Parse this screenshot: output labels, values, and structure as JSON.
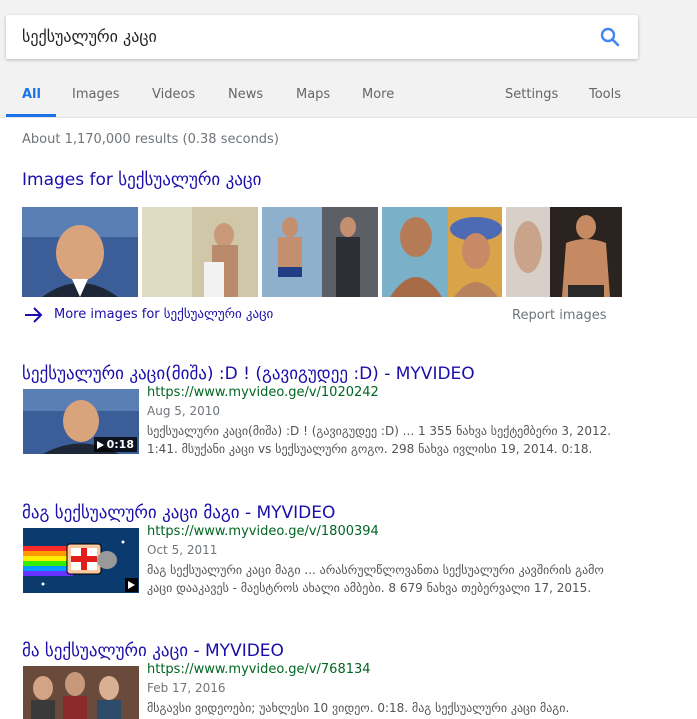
{
  "search": {
    "query": "სექსუალური კაცი"
  },
  "tabs": {
    "all": "All",
    "images": "Images",
    "videos": "Videos",
    "news": "News",
    "maps": "Maps",
    "more": "More",
    "settings": "Settings",
    "tools": "Tools"
  },
  "stats": "About 1,170,000 results (0.38 seconds)",
  "images_section": {
    "heading": "Images for სექსუალური კაცი",
    "more_link": "More images for სექსუალური კაცი",
    "report": "Report images"
  },
  "results": [
    {
      "title": "სექსუალური კაცი(მიშა) :D ! (გავიგუდეე :D) - MYVIDEO",
      "url": "https://www.myvideo.ge/v/1020242",
      "date": "Aug 5, 2010",
      "snippet": "სექსუალური კაცი(მიშა) :D ! (გავიგუდეე :D) ... 1 355 ნახვა სექტემბერი 3, 2012. 1:41. მსუქანი კაცი vs სექსუალური გოგო. 298 ნახვა ივლისი 19, 2014. 0:18.",
      "duration": "0:18"
    },
    {
      "title": "მაგ სექსუალური კაცი მაგი - MYVIDEO",
      "url": "https://www.myvideo.ge/v/1800394",
      "date": "Oct 5, 2011",
      "snippet": "მაგ სექსუალური კაცი მაგი ... არასრულწლოვანთა სექსუალური კავშირის გამო კაცი დააკავეს - მაესტროს ახალი ამბები. 8 679 ნახვა თებერვალი 17, 2015."
    },
    {
      "title": "მა სექსუალური კაცი - MYVIDEO",
      "url": "https://www.myvideo.ge/v/768134",
      "date": "Feb 17, 2016",
      "snippet": "მსგავსი ვიდეოები; უახლესი 10 ვიდეო. 0:18. მაგ სექსუალური კაცი მაგი."
    }
  ],
  "colors": {
    "link": "#1a0dab",
    "url": "#006621",
    "accent": "#1a73e8"
  }
}
